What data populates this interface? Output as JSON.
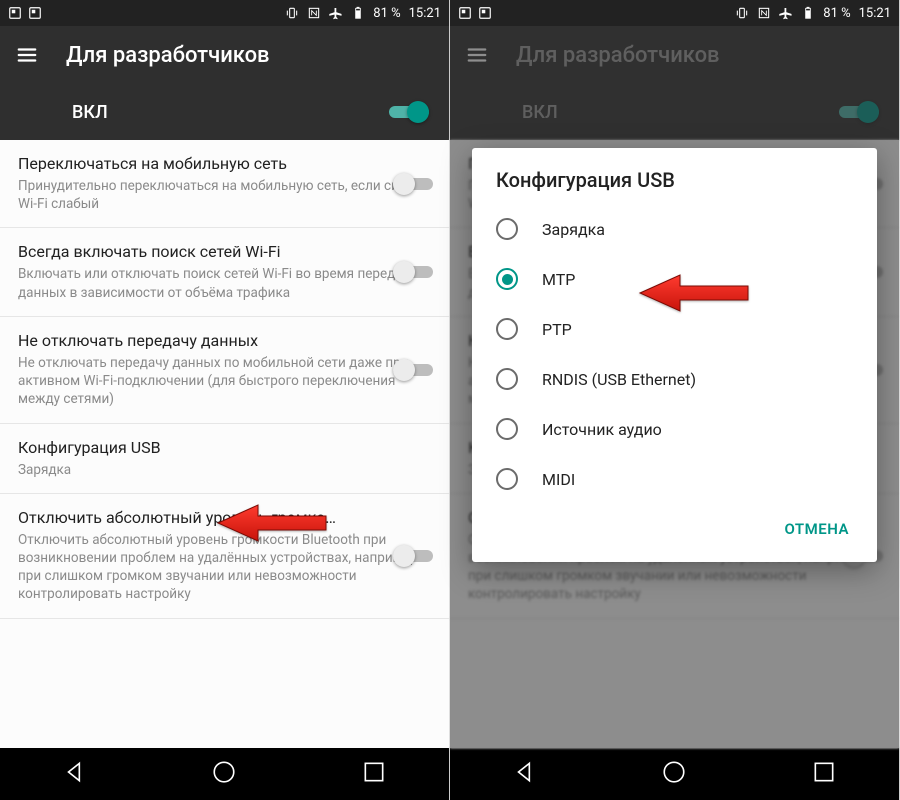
{
  "statusbar": {
    "battery_pct": "81 %",
    "time": "15:21"
  },
  "appbar": {
    "title": "Для разработчиков"
  },
  "master_toggle": {
    "label": "ВКЛ"
  },
  "settings": [
    {
      "title": "Переключаться на мобильную сеть",
      "sub": "Принудительно переключаться на мобильную сеть, если сигнал Wi-Fi слабый",
      "toggle": false
    },
    {
      "title": "Всегда включать поиск сетей Wi-Fi",
      "sub": "Включать или отключать поиск сетей Wi-Fi во время передачи данных в зависимости от объёма трафика",
      "toggle": false
    },
    {
      "title": "Не отключать передачу данных",
      "sub": "Не отключать передачу данных по мобильной сети даже при активном Wi-Fi-подключении (для быстрого переключения между сетями)",
      "toggle": false
    },
    {
      "title": "Конфигурация USB",
      "sub": "Зарядка",
      "toggle": null
    },
    {
      "title": "Отключить абсолютный уровень громко…",
      "sub": "Отключить абсолютный уровень громкости Bluetooth при возникновении проблем на удалённых устройствах, например при слишком громком звучании или невозможности контролировать настройку",
      "toggle": false
    }
  ],
  "dialog": {
    "title": "Конфигурация USB",
    "options": [
      {
        "label": "Зарядка",
        "selected": false
      },
      {
        "label": "MTP",
        "selected": true
      },
      {
        "label": "PTP",
        "selected": false
      },
      {
        "label": "RNDIS (USB Ethernet)",
        "selected": false
      },
      {
        "label": "Источник аудио",
        "selected": false
      },
      {
        "label": "MIDI",
        "selected": false
      }
    ],
    "cancel": "ОТМЕНА"
  }
}
